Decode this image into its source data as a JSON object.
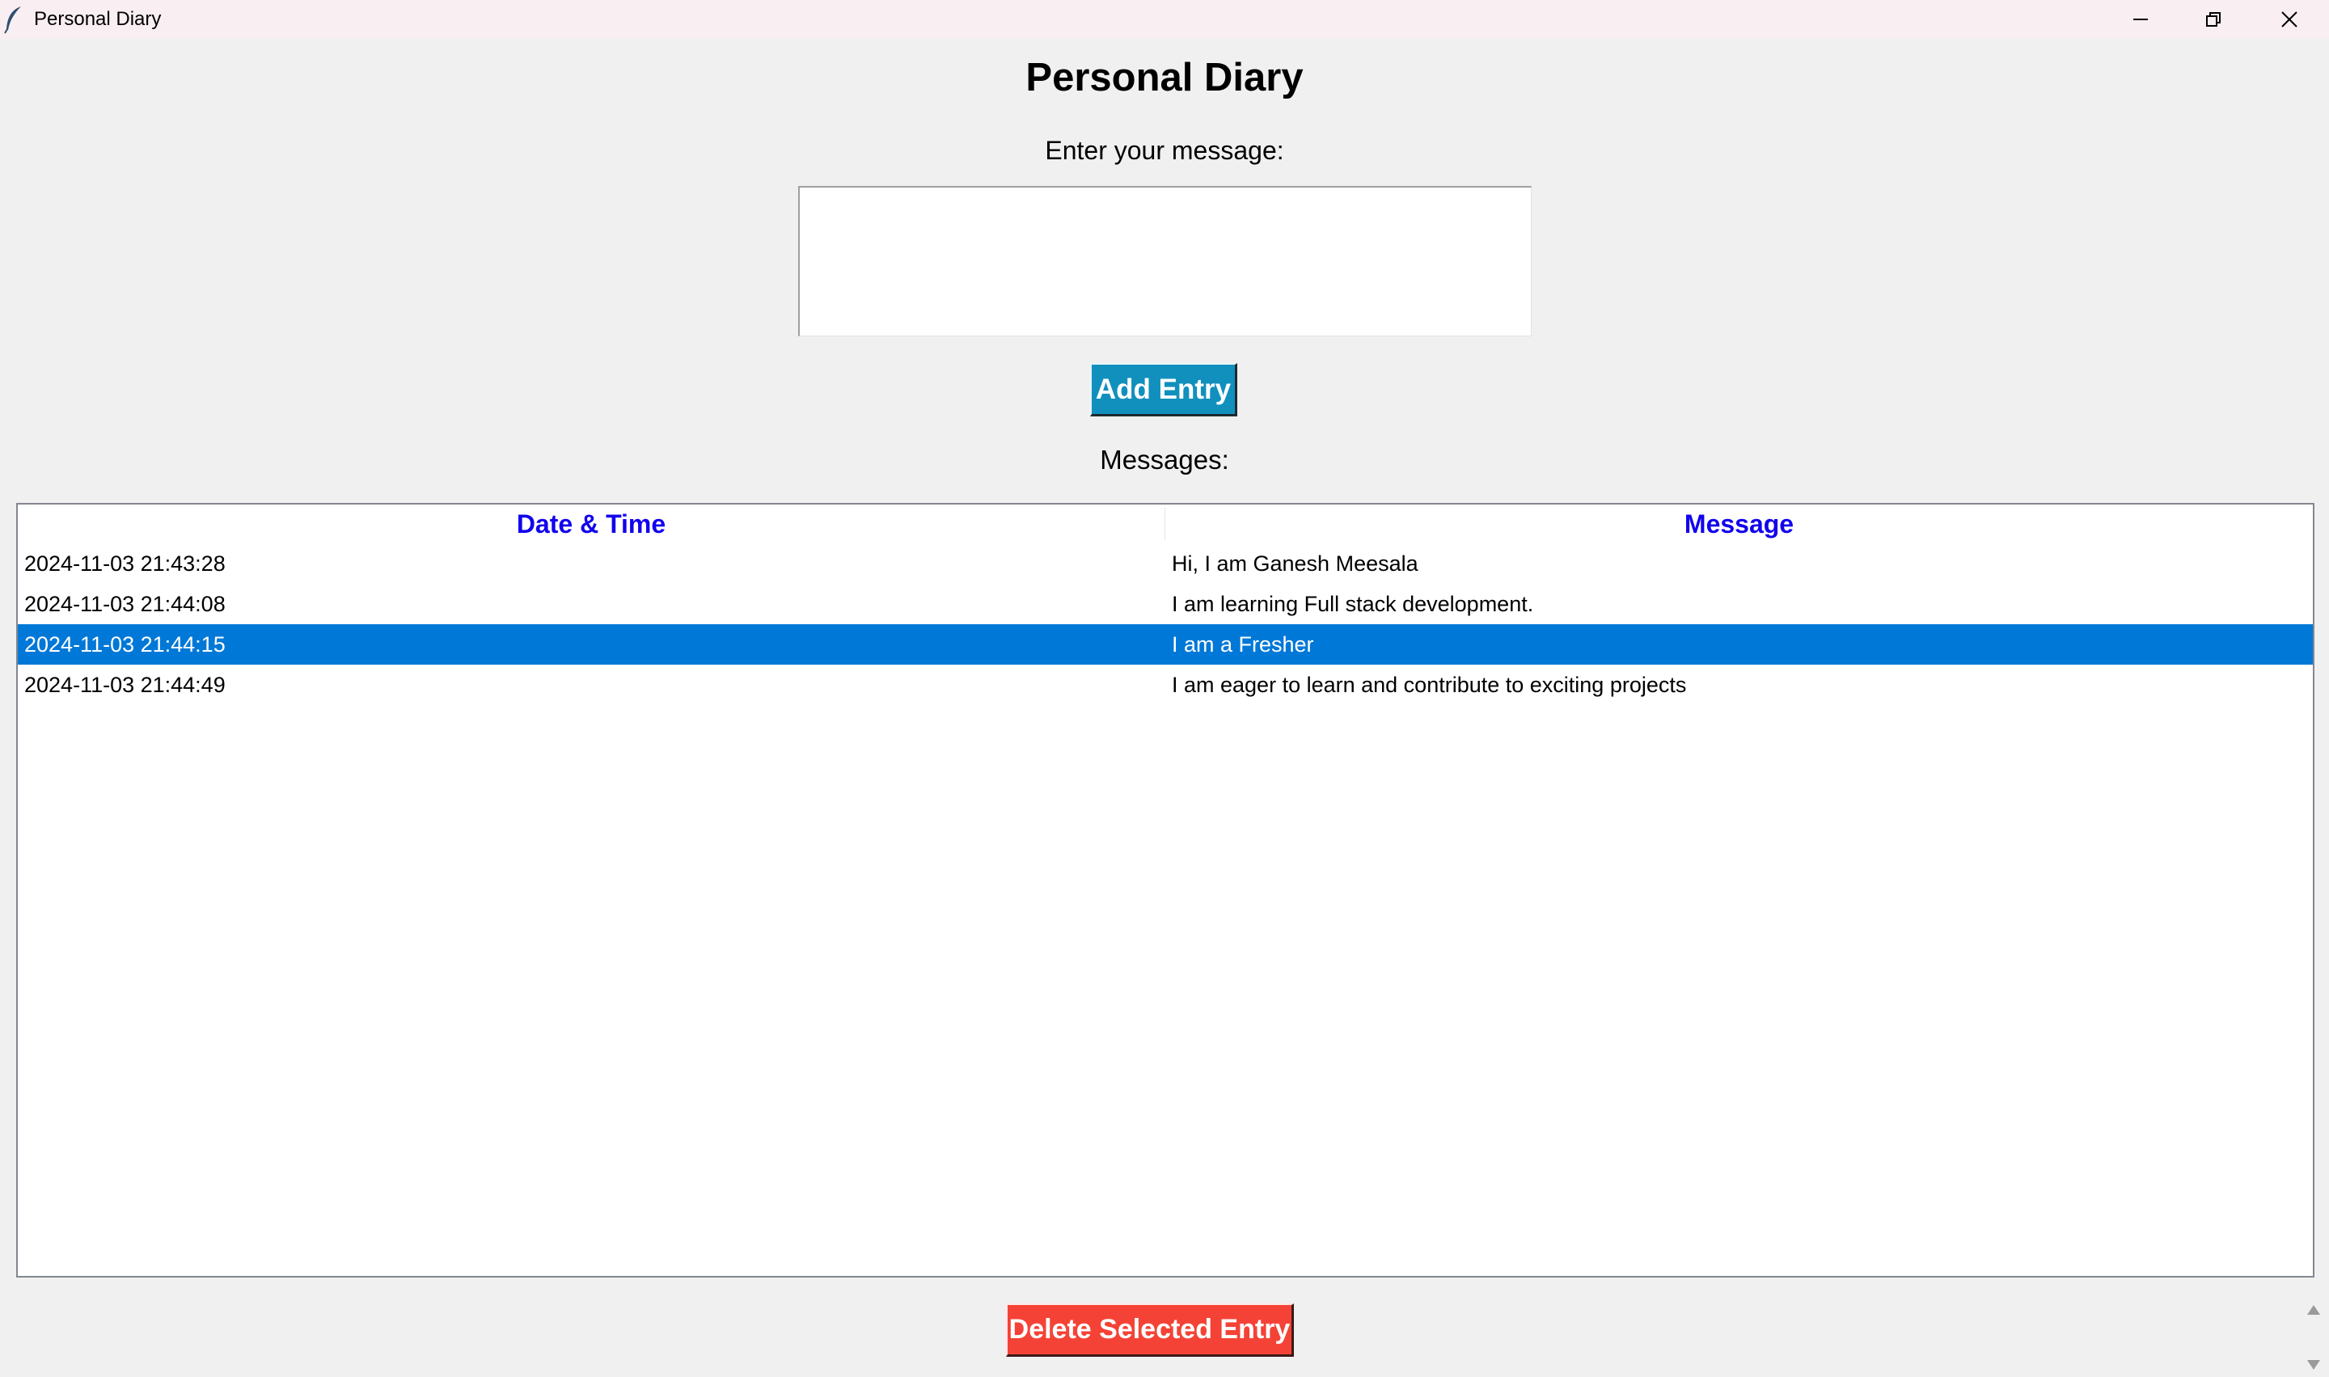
{
  "window": {
    "title": "Personal Diary",
    "icon": "feather-icon",
    "controls": [
      "minimize-icon",
      "restore-icon",
      "close-icon"
    ]
  },
  "main": {
    "heading": "Personal Diary",
    "prompt": "Enter your message:",
    "entry_value": "",
    "add_button": "Add Entry",
    "messages_label": "Messages:"
  },
  "table": {
    "columns": [
      "Date & Time",
      "Message"
    ],
    "rows": [
      {
        "datetime": "2024-11-03 21:43:28",
        "message": "Hi, I am Ganesh Meesala"
      },
      {
        "datetime": "2024-11-03 21:44:08",
        "message": "I am learning Full stack development."
      },
      {
        "datetime": "2024-11-03 21:44:15",
        "message": "I am a Fresher"
      },
      {
        "datetime": "2024-11-03 21:44:49",
        "message": "I am eager to learn and contribute to exciting projects"
      }
    ],
    "selected_row": 2
  },
  "footer": {
    "delete_button": "Delete Selected Entry"
  },
  "colors": {
    "header_text": "#1100ee",
    "selection": "#0078d7",
    "add_button": "#1190bd",
    "delete_button": "#f44336",
    "background": "#f0f0f0"
  }
}
